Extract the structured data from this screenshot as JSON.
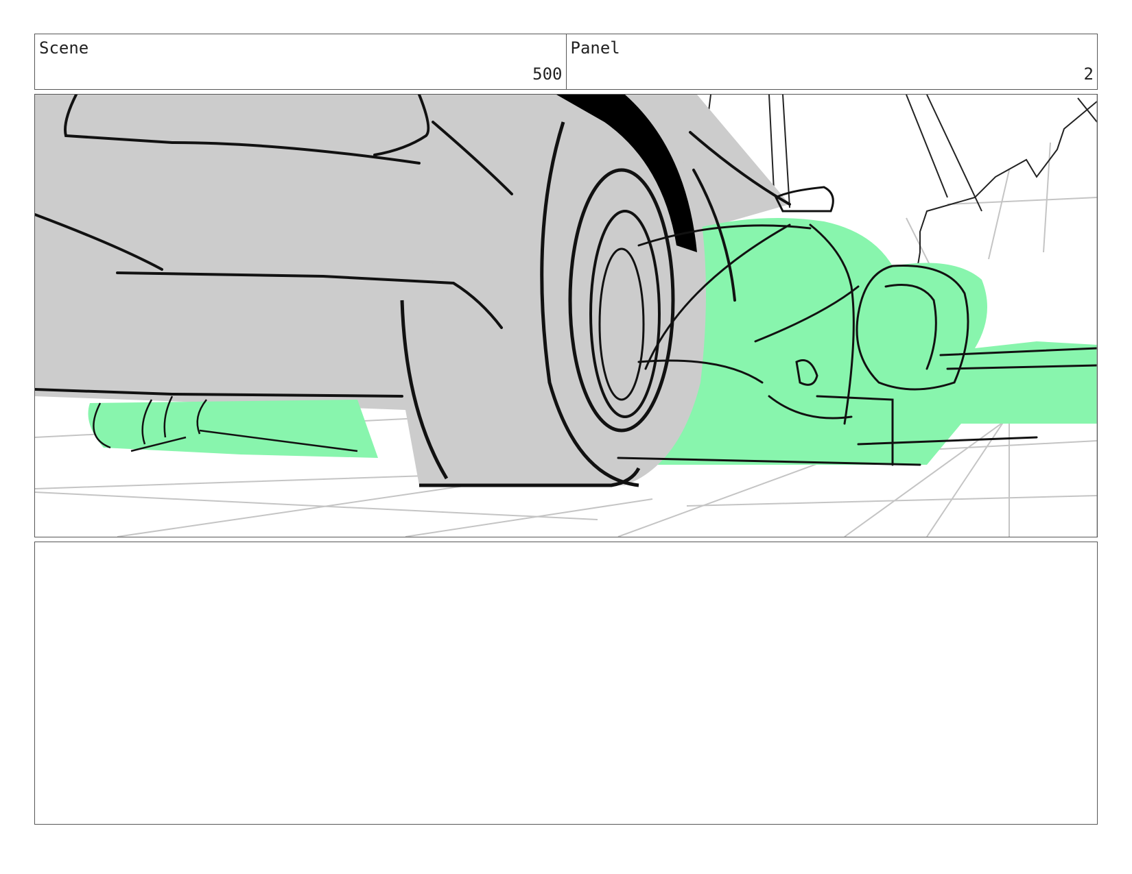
{
  "sheet": {
    "scene_label": "Scene",
    "scene_number": "500",
    "panel_label": "Panel",
    "panel_number": "2"
  },
  "drawing": {
    "description_colors": {
      "car_body": "#cccccc",
      "character_highlight": "#88f5ad",
      "ink": "#111111",
      "floor_grid": "#c0c0c0",
      "tire_shadow": "#000000"
    }
  },
  "notes": {
    "text": ""
  }
}
